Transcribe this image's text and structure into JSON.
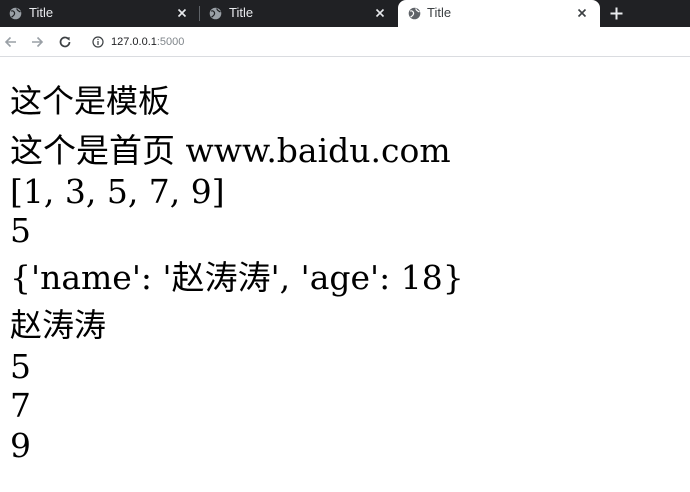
{
  "tabs": [
    {
      "title": "Title",
      "active": false
    },
    {
      "title": "Title",
      "active": false
    },
    {
      "title": "Title",
      "active": true
    }
  ],
  "address_bar": {
    "host": "127.0.0.1",
    "port": ":5000"
  },
  "colors": {
    "tabstrip_bg": "#202124",
    "active_tab_bg": "#ffffff",
    "page_bg": "#ffffff",
    "text": "#000000"
  },
  "page": {
    "lines": [
      "这个是模板",
      "这个是首页 www.baidu.com",
      "[1, 3, 5, 7, 9]",
      "5",
      "{'name': '赵涛涛', 'age': 18}",
      "赵涛涛",
      "5",
      "7",
      "9"
    ]
  }
}
